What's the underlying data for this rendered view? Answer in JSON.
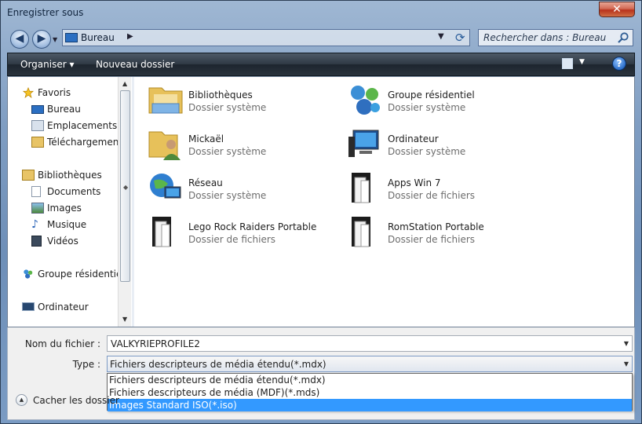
{
  "window": {
    "title": "Enregistrer sous",
    "close_glyph": "✕"
  },
  "address": {
    "location": "Bureau",
    "back_glyph": "◀",
    "forward_glyph": "▶"
  },
  "search": {
    "placeholder": "Rechercher dans : Bureau"
  },
  "toolbar": {
    "organize_label": "Organiser ▾",
    "new_folder_label": "Nouveau dossier",
    "help_glyph": "?"
  },
  "nav": {
    "favorites": {
      "label": "Favoris",
      "icon": "star-icon"
    },
    "favorites_items": [
      {
        "label": "Bureau",
        "icon": "desktop-icon"
      },
      {
        "label": "Emplacements ré",
        "icon": "recent-places-icon"
      },
      {
        "label": "Téléchargements",
        "icon": "downloads-icon"
      }
    ],
    "libraries": {
      "label": "Bibliothèques",
      "icon": "library-icon"
    },
    "libraries_items": [
      {
        "label": "Documents",
        "icon": "documents-icon"
      },
      {
        "label": "Images",
        "icon": "pictures-icon"
      },
      {
        "label": "Musique",
        "icon": "music-icon"
      },
      {
        "label": "Vidéos",
        "icon": "videos-icon"
      }
    ],
    "homegroup": {
      "label": "Groupe résidentiel",
      "icon": "homegroup-icon"
    },
    "computer": {
      "label": "Ordinateur",
      "icon": "computer-icon"
    }
  },
  "items": [
    {
      "name": "Bibliothèques",
      "kind": "Dossier système",
      "icon": "library-icon"
    },
    {
      "name": "Groupe résidentiel",
      "kind": "Dossier système",
      "icon": "homegroup-icon"
    },
    {
      "name": "Mickaël",
      "kind": "Dossier système",
      "icon": "user-folder-icon"
    },
    {
      "name": "Ordinateur",
      "kind": "Dossier système",
      "icon": "computer-icon"
    },
    {
      "name": "Réseau",
      "kind": "Dossier système",
      "icon": "network-icon"
    },
    {
      "name": "Apps Win 7",
      "kind": "Dossier de fichiers",
      "icon": "folder-icon"
    },
    {
      "name": "Lego Rock Raiders Portable",
      "kind": "Dossier de fichiers",
      "icon": "folder-icon"
    },
    {
      "name": "RomStation Portable",
      "kind": "Dossier de fichiers",
      "icon": "folder-icon"
    }
  ],
  "form": {
    "filename_label": "Nom du fichier :",
    "filename_value": "VALKYRIEPROFILE2",
    "type_label": "Type :",
    "type_value": "Fichiers descripteurs de média étendu(*.mdx)",
    "type_options": [
      "Fichiers descripteurs de média étendu(*.mdx)",
      "Fichiers descripteurs de média (MDF)(*.mds)",
      "Images Standard ISO(*.iso)"
    ],
    "highlighted_option_index": 2,
    "hide_folders_label": "Cacher les dossier"
  },
  "colors": {
    "selection": "#3399ff",
    "toolbar": "#2e3843"
  }
}
